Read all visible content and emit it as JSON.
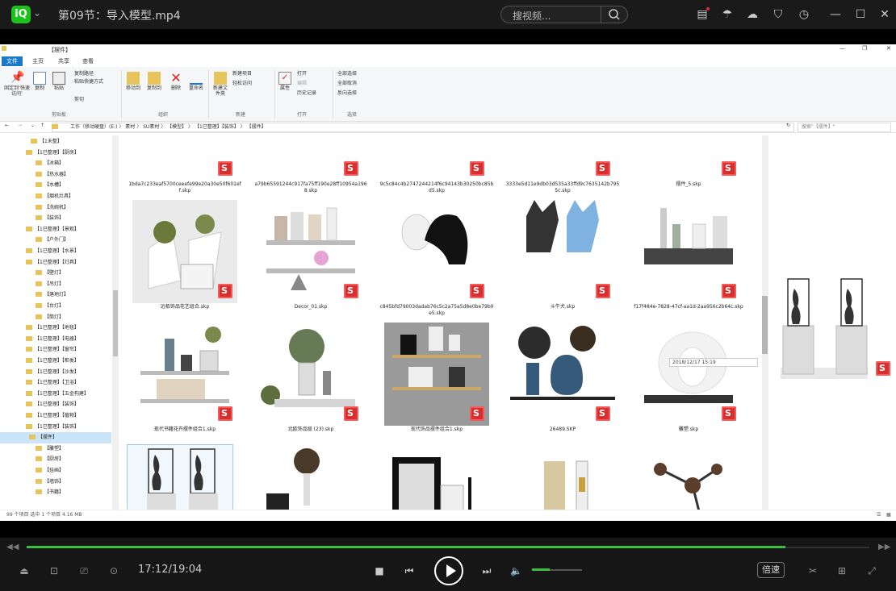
{
  "player": {
    "logo": "iQ",
    "title": "第09节：导入模型.mp4",
    "search_placeholder": "搜视频...",
    "time": "17:12/19:04",
    "progress": 0.9,
    "volume": 0.35,
    "speed_label": "倍速"
  },
  "explorer": {
    "window_title": "【摆件】",
    "ribbon_tabs": [
      "文件",
      "主页",
      "共享",
      "查看"
    ],
    "ribbon_buttons": {
      "pin": "固定到'快速访问'",
      "copy": "复制",
      "paste": "粘贴",
      "copy_path": "复制路径",
      "paste_shortcut": "粘贴快捷方式",
      "cut": "剪切",
      "move_to": "移动到",
      "copy_to": "复制到",
      "delete": "删除",
      "rename": "重命名",
      "new_folder": "新建文件夹",
      "new_item": "新建项目",
      "easy_access": "轻松访问",
      "properties": "属性",
      "open": "打开",
      "edit": "编辑",
      "history": "历史记录",
      "select_all": "全部选择",
      "select_none": "全部取消",
      "invert": "反向选择"
    },
    "ribbon_groups": [
      "剪贴板",
      "组织",
      "新建",
      "打开",
      "选择"
    ],
    "breadcrumb": "工作（移动硬盘）(E:)  〉 素材  〉 SU素材  〉 【模型】  〉 【1已整理】【装饰】  〉 【摆件】",
    "search_placeholder": "搜索\"【摆件】\"",
    "nav_items": [
      "【1未整】",
      "【1已整理】【厨房】",
      "【冰箱】",
      "【热水器】",
      "【水槽】",
      "【烟机灶具】",
      "【洗碗机】",
      "【装饰】",
      "【1已整理】【景观】",
      "【户外门】",
      "【1已整理】【水景】",
      "【1已整理】【灯具】",
      "【壁灯】",
      "【吊灯】",
      "【落地灯】",
      "【台灯】",
      "【筒灯】",
      "【1已整理】【地毯】",
      "【1已整理】【电器】",
      "【1已整理】【窗帘】",
      "【1已整理】【柜类】",
      "【1已整理】【沙发】",
      "【1已整理】【卫浴】",
      "【1已整理】【五金构建】",
      "【1已整理】【装饰】",
      "【1已整理】【植物】",
      "【1已整理】【装饰】",
      "【摆件】",
      "【雕塑】",
      "【厨房】",
      "【挂画】",
      "【墙饰】",
      "【书籍】"
    ],
    "files": [
      "1bda7c233eaf5700ceeefe99e20a30e50f601eff.skp",
      "a79b65591244c917fa75ff190e28ff10954a1968.skp",
      "9c5c84c4b2747244214f6c94143b30250bc85bd5.skp",
      "3333e5d11e9db03d535a33ffd9c7635142b7955c.skp",
      "摆件_5.skp",
      "远栢饰品花艺组合.skp",
      "Decor_01.skp",
      "c845bfd79003dadab76c5c2a75a5d8e0be79b0e5.skp",
      "斗牛犬.skp",
      "f17f484e-7828-47cf-aa1d-2aa956c2b64c.skp",
      "现代书籍花卉摆件组合1.skp",
      "北欧饰品级 (23).skp",
      "现代饰品摆件组合1.skp",
      "26489.SKP",
      "雕塑.skp",
      "",
      "",
      "",
      "",
      ""
    ],
    "tooltip": "2018/12/17 15:19",
    "status": "99 个项目    选中 1 个项目  4.16 MB"
  },
  "icons": {
    "top": [
      "clipboard-icon",
      "mushroom-icon",
      "cloud-icon",
      "shirt-icon",
      "clock-icon",
      "minimize-icon",
      "maximize-icon",
      "close-icon"
    ],
    "controls": [
      "eject-icon",
      "screenshot-icon",
      "cast-icon",
      "record-icon",
      "stop-icon",
      "prev-icon",
      "play-icon",
      "next-icon",
      "volume-icon",
      "cut-icon",
      "gift-icon",
      "fullscreen-icon"
    ]
  },
  "colors": {
    "accent": "#3fbf3f",
    "ribbon_tab": "#1979ca",
    "skp_badge": "#d92e2e"
  }
}
